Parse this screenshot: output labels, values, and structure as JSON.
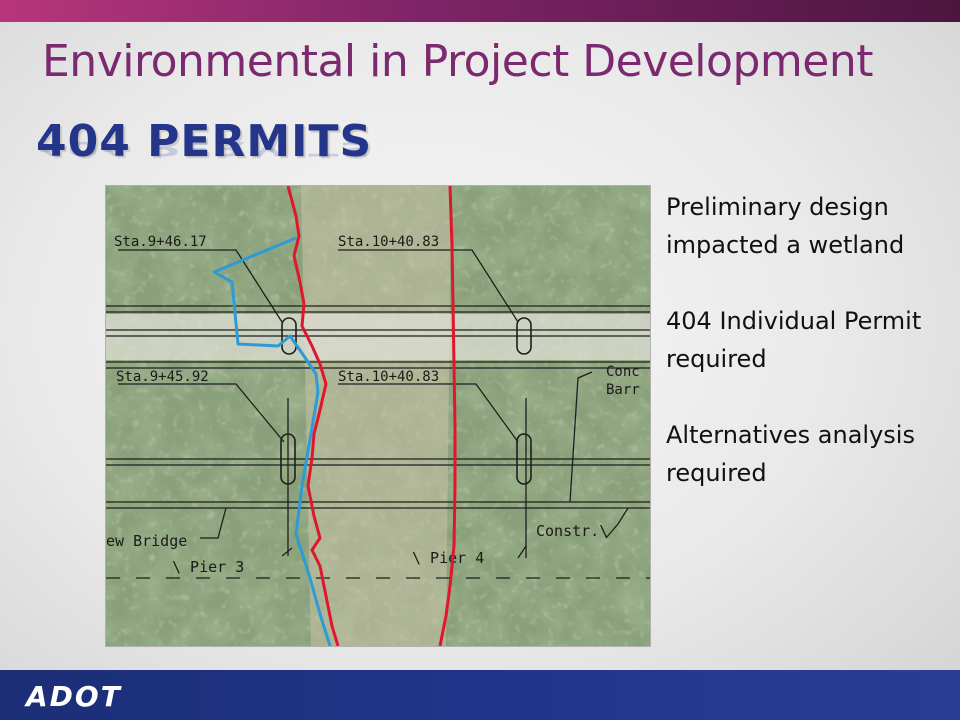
{
  "slide": {
    "title": "Environmental in Project Development",
    "subtitle": "404 PERMITS"
  },
  "figure": {
    "labels": {
      "sta_top_left": "Sta.9+46.17",
      "sta_top_right": "Sta.10+40.83",
      "sta_mid_left": "Sta.9+45.92",
      "sta_mid_right": "Sta.10+40.83",
      "conc": "Conc",
      "barr": "Barr",
      "new_bridge": "ew Bridge",
      "pier3": "\\ Pier 3",
      "pier4": "\\ Pier 4",
      "constr": "Constr.\\"
    },
    "colors": {
      "red_line": "#e0162f",
      "blue_line": "#2e9bd6"
    }
  },
  "bullets": [
    "Preliminary design impacted a wetland",
    "404 Individual Permit required",
    "Alternatives analysis required"
  ],
  "footer": {
    "logo": "ADOT"
  },
  "colors": {
    "title": "#7b2a6f",
    "subtitle": "#24358a",
    "top_bar": "#7d2466",
    "bottom_bar": "#21348a"
  }
}
